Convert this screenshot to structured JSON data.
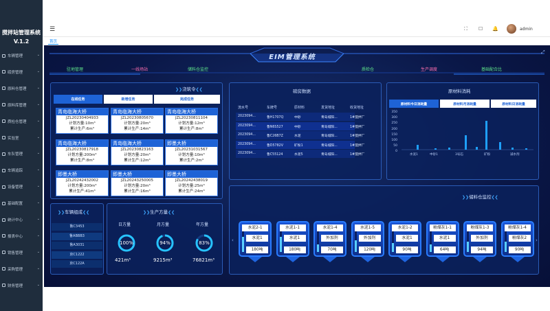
{
  "app": {
    "name": "搅拌站管理系统",
    "version": "V.1.2"
  },
  "sidebar": {
    "items": [
      {
        "label": "车辆管理"
      },
      {
        "label": "磅房管理"
      },
      {
        "label": "原料仓管理"
      },
      {
        "label": "原料库管理"
      },
      {
        "label": "质检仓管理"
      },
      {
        "label": "实验室"
      },
      {
        "label": "车队管理"
      },
      {
        "label": "车辆追踪"
      },
      {
        "label": "设备管理"
      },
      {
        "label": "基础配置"
      },
      {
        "label": "统计中心"
      },
      {
        "label": "报表中心"
      },
      {
        "label": "销售管理"
      },
      {
        "label": "采购管理"
      },
      {
        "label": "财务管理"
      }
    ]
  },
  "header": {
    "user": "admin",
    "tab_home": "首页"
  },
  "screen": {
    "title": "EIM管理系统",
    "modules": [
      "驻地管理",
      "一线场站",
      "储料仓监控",
      "质检仓",
      "生产调度",
      "基础配合比"
    ],
    "orders": {
      "title": "浇筑令",
      "tabs": [
        "在线任务",
        "新增任务",
        "完成任务"
      ],
      "cards": [
        {
          "name": "青岛临海大桥",
          "no": "JZL20230404933",
          "plan": "计划方量:10m³",
          "done": "累计生产:6m³"
        },
        {
          "name": "青岛临海大桥",
          "no": "JZL20230805670",
          "plan": "计划方量:20m³",
          "done": "累计生产:14m³"
        },
        {
          "name": "青岛临海大桥",
          "no": "JZL20230811104",
          "plan": "计划方量:12m³",
          "done": "累计生产:8m³"
        },
        {
          "name": "青岛临海大桥",
          "no": "JZL20230817918",
          "plan": "计划方量:200m³",
          "done": "累计生产:8m³"
        },
        {
          "name": "青岛临海大桥",
          "no": "JZL20230823163",
          "plan": "计划方量:20m³",
          "done": "累计生产:12m³"
        },
        {
          "name": "即墨大桥",
          "no": "JZL20231031567",
          "plan": "计划方量:10m³",
          "done": "累计生产:2m³"
        },
        {
          "name": "即墨大桥",
          "no": "JZL20242432002",
          "plan": "计划方量:200m³",
          "done": "累计生产:41m³"
        },
        {
          "name": "即墨大桥",
          "no": "JZL20243250005",
          "plan": "计划方量:20m³",
          "done": "累计生产:16m³"
        },
        {
          "name": "即墨大桥",
          "no": "JZL20242438019",
          "plan": "计划方量:25m³",
          "done": "累计生产:24m³"
        }
      ]
    },
    "weigh": {
      "title": "磅房数据",
      "columns": [
        "流水号",
        "车牌号",
        "原材料",
        "发货地址",
        "收货地址"
      ],
      "rows": [
        [
          "2023094...",
          "鲁H1707Q",
          "中砂",
          "青岛城阳...",
          "1#搅拌厂"
        ],
        [
          "2023094...",
          "鲁N6S527",
          "中砂",
          "青岛城阳...",
          "1#搅拌厂"
        ],
        [
          "2023094...",
          "鲁C26B7Z",
          "水泥",
          "青岛城阳...",
          "1#搅拌厂"
        ],
        [
          "2023094...",
          "鲁D5782V",
          "矿粉1",
          "青岛城阳...",
          "1#搅拌厂"
        ],
        [
          "2023094...",
          "鲁C55124",
          "水泥5",
          "青岛城阳...",
          "1#搅拌厂"
        ]
      ]
    },
    "consumption": {
      "title": "原材料消耗",
      "tabs": [
        "原材料今日消耗量",
        "原材料月消耗量",
        "原材料日消耗量"
      ],
      "y_ticks": [
        "350",
        "300",
        "250",
        "200",
        "150",
        "100",
        "50",
        "0"
      ],
      "x_labels": [
        "水泥1",
        "中砂1",
        "3号石",
        "矿粉",
        "减水剂"
      ]
    },
    "vehicles": {
      "title": "车辆组成",
      "rows": [
        "鲁C3453",
        "鲁ABBB3",
        "鲁A3031",
        "京C1222",
        "京C122A"
      ]
    },
    "production": {
      "title": "生产方量",
      "gauges": [
        {
          "label": "日方量",
          "percent": "100%",
          "pct": 100,
          "value": "421m³"
        },
        {
          "label": "月方量",
          "percent": "94%",
          "pct": 94,
          "value": "9215m³"
        },
        {
          "label": "年方量",
          "percent": "83%",
          "pct": 83,
          "value": "76821m³"
        }
      ]
    },
    "silos": {
      "title": "储料仓监控",
      "items": [
        {
          "name": "水泥2-1",
          "type": "水泥1",
          "amount": "180吨",
          "level": 0.6
        },
        {
          "name": "水泥1-1",
          "type": "水泥1",
          "amount": "180吨",
          "level": 0.6
        },
        {
          "name": "水泥1-4",
          "type": "外加剂",
          "amount": "70吨",
          "level": 0.3
        },
        {
          "name": "水泥1-5",
          "type": "外加剂",
          "amount": "120吨",
          "level": 0.45
        },
        {
          "name": "水泥1-2",
          "type": "水泥1",
          "amount": "90吨",
          "level": 0.35
        },
        {
          "name": "粉煤灰1-1",
          "type": "水泥1",
          "amount": "64吨",
          "level": 0.3
        },
        {
          "name": "粉煤灰1-3",
          "type": "外加剂",
          "amount": "94吨",
          "level": 0.4
        },
        {
          "name": "粉煤灰1-4",
          "type": "粉煤灰2",
          "amount": "90吨",
          "level": 0.4
        }
      ]
    },
    "colors": {
      "accent": "#1e63d6",
      "bg": "#0b1a4a",
      "module_green": "#5de28a",
      "module_pink": "#ff6fb0",
      "bar": "#1ea0ff"
    }
  }
}
